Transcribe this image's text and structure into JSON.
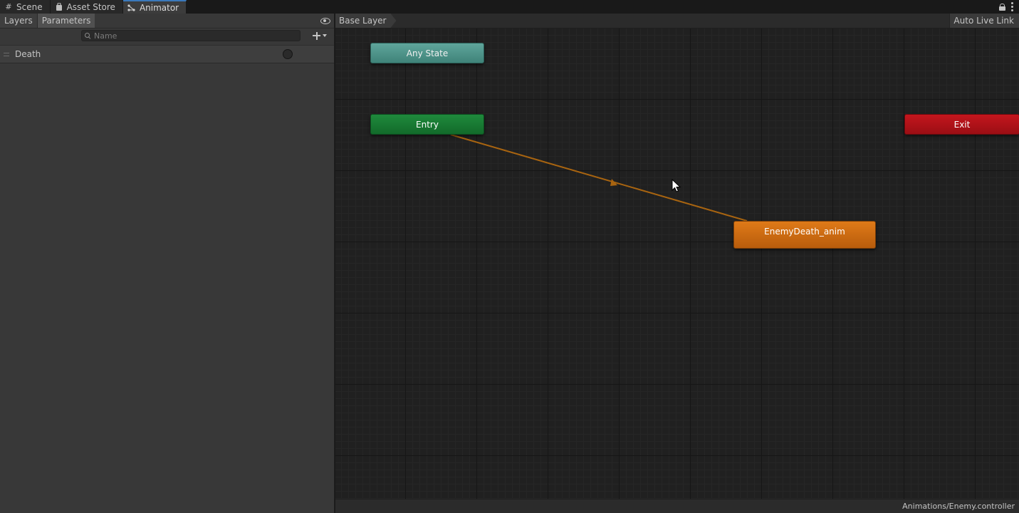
{
  "tabs": [
    {
      "label": "Scene",
      "icon": "grid-icon"
    },
    {
      "label": "Asset Store",
      "icon": "shopping-bag-icon"
    },
    {
      "label": "Animator",
      "icon": "animator-icon"
    }
  ],
  "active_tab": "Animator",
  "left_panel": {
    "tabs": {
      "layers": "Layers",
      "parameters": "Parameters"
    },
    "search": {
      "placeholder": "Name",
      "value": ""
    },
    "parameters": [
      {
        "name": "Death",
        "type": "trigger"
      }
    ]
  },
  "graph": {
    "breadcrumb": "Base Layer",
    "auto_live_link": "Auto Live Link",
    "nodes": {
      "any_state": "Any State",
      "entry": "Entry",
      "exit": "Exit",
      "state": "EnemyDeath_anim"
    },
    "controller_path": "Animations/Enemy.controller"
  },
  "colors": {
    "any_state": "#4f958b",
    "entry": "#18793a",
    "exit": "#ae1117",
    "state": "#c86a12",
    "transition": "#a86410",
    "active_tab_accent": "#3a79bb"
  }
}
